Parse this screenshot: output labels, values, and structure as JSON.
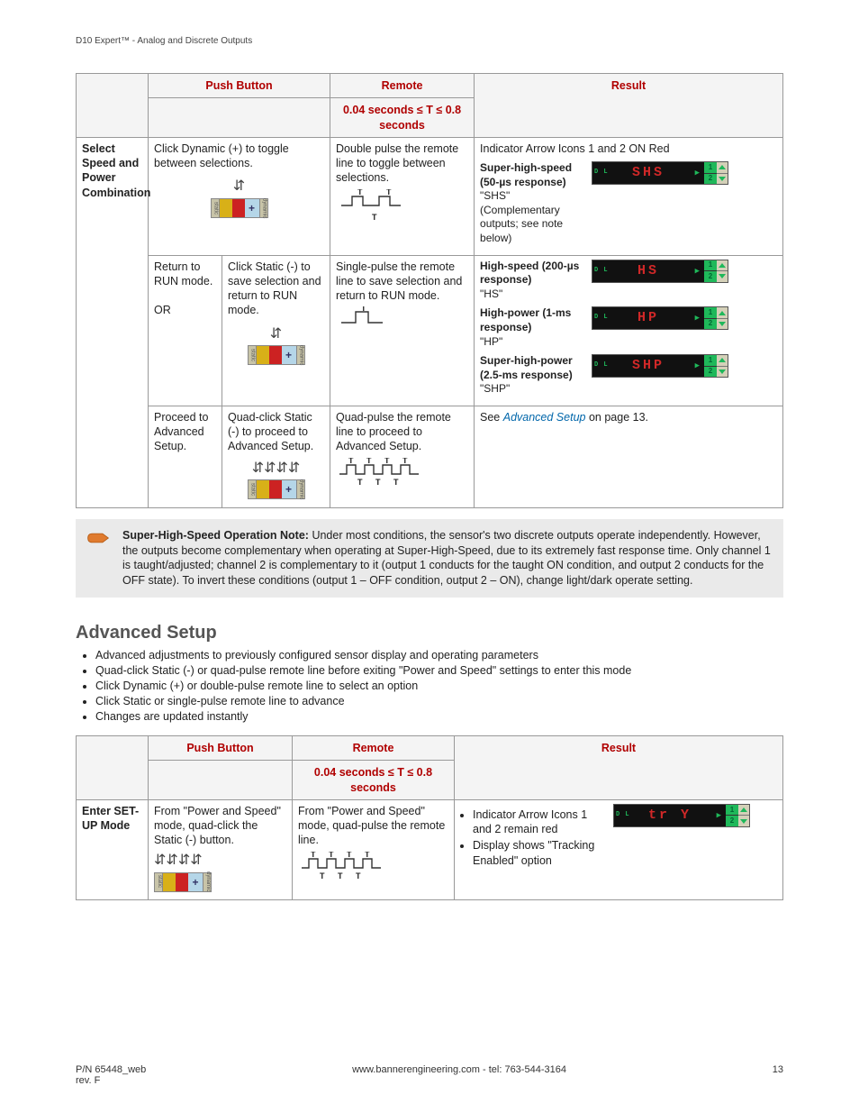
{
  "doc_header": "D10 Expert™ - Analog and Discrete Outputs",
  "table1": {
    "headers": {
      "push": "Push Button",
      "remote": "Remote",
      "result": "Result"
    },
    "remote_sub": "0.04 seconds ≤ T ≤ 0.8 seconds",
    "row_label": "Select Speed and Power Combination",
    "r1": {
      "push": "Click Dynamic (+) to toggle between selections.",
      "remote": "Double pulse the remote line to toggle between selections.",
      "result_top": "Indicator Arrow Icons 1 and 2 ON Red",
      "shs_lbl": "Super-high-speed (50-µs response)",
      "shs_q": "\"SHS\" (Complementary outputs; see note below)",
      "shs_disp": "SHS"
    },
    "r2": {
      "push_a": "Return to RUN mode.",
      "push_or": "OR",
      "push_b": "Click Static (-) to save selection and return to RUN mode.",
      "remote": "Single-pulse the remote line to save selection and return to RUN mode.",
      "hs_lbl": "High-speed (200-µs response)",
      "hs_q": "\"HS\"",
      "hs_disp": "HS",
      "hp_lbl": "High-power (1-ms response)",
      "hp_q": "\"HP\"",
      "hp_disp": "HP",
      "shp_lbl": "Super-high-power (2.5-ms response)",
      "shp_q": "\"SHP\"",
      "shp_disp": "SHP"
    },
    "r3": {
      "push_a": "Proceed to Advanced Setup.",
      "push_b": "Quad-click Static (-) to proceed to Advanced Setup.",
      "remote": "Quad-pulse the remote line to proceed to Advanced Setup.",
      "result_pre": "See ",
      "result_link": "Advanced Setup",
      "result_post": " on page 13."
    }
  },
  "note": {
    "title": "Super-High-Speed Operation Note: ",
    "body": "Under most conditions, the sensor's two discrete outputs operate independently. However, the outputs become complementary when operating at Super-High-Speed, due to its extremely fast response time. Only channel 1 is taught/adjusted; channel 2 is complementary to it (output 1 conducts for the taught ON condition, and output 2 conducts for the OFF state). To invert these conditions (output 1 – OFF condition, output 2 – ON), change light/dark operate setting."
  },
  "advsetup": {
    "heading": "Advanced Setup",
    "bullets": [
      "Advanced adjustments to previously configured sensor display and operating parameters",
      "Quad-click Static (-) or quad-pulse remote line before exiting \"Power and Speed\" settings to enter this mode",
      "Click Dynamic (+) or double-pulse remote line to select an option",
      "Click Static or single-pulse remote line to advance",
      "Changes are updated instantly"
    ]
  },
  "table2": {
    "headers": {
      "push": "Push Button",
      "remote": "Remote",
      "result": "Result"
    },
    "remote_sub": "0.04 seconds ≤ T ≤ 0.8 seconds",
    "row_label": "Enter SET-UP Mode",
    "push": "From \"Power and Speed\" mode, quad-click the Static (-) button.",
    "remote": "From \"Power and Speed\" mode, quad-pulse the remote line.",
    "res_b1": "Indicator Arrow Icons 1 and 2 remain red",
    "res_b2": "Display shows \"Tracking Enabled\" option",
    "disp": "tr  Y"
  },
  "footer": {
    "left1": "P/N 65448_web",
    "left2": "rev. F",
    "center": "www.bannerengineering.com - tel: 763-544-3164",
    "right": "13"
  },
  "device_labels": {
    "static": "static",
    "dynamic": "dynamic",
    "plus": "+"
  },
  "channels": {
    "one": "1",
    "two": "2"
  },
  "disp_dl": "D L"
}
